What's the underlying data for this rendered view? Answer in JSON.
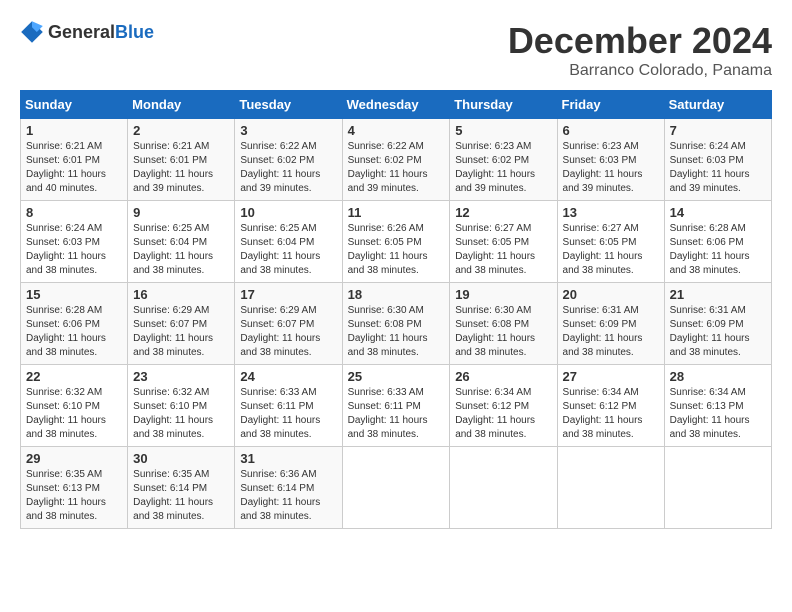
{
  "header": {
    "logo_general": "General",
    "logo_blue": "Blue",
    "title": "December 2024",
    "location": "Barranco Colorado, Panama"
  },
  "days_of_week": [
    "Sunday",
    "Monday",
    "Tuesday",
    "Wednesday",
    "Thursday",
    "Friday",
    "Saturday"
  ],
  "weeks": [
    [
      {
        "day": "1",
        "info": "Sunrise: 6:21 AM\nSunset: 6:01 PM\nDaylight: 11 hours and 40 minutes."
      },
      {
        "day": "2",
        "info": "Sunrise: 6:21 AM\nSunset: 6:01 PM\nDaylight: 11 hours and 39 minutes."
      },
      {
        "day": "3",
        "info": "Sunrise: 6:22 AM\nSunset: 6:02 PM\nDaylight: 11 hours and 39 minutes."
      },
      {
        "day": "4",
        "info": "Sunrise: 6:22 AM\nSunset: 6:02 PM\nDaylight: 11 hours and 39 minutes."
      },
      {
        "day": "5",
        "info": "Sunrise: 6:23 AM\nSunset: 6:02 PM\nDaylight: 11 hours and 39 minutes."
      },
      {
        "day": "6",
        "info": "Sunrise: 6:23 AM\nSunset: 6:03 PM\nDaylight: 11 hours and 39 minutes."
      },
      {
        "day": "7",
        "info": "Sunrise: 6:24 AM\nSunset: 6:03 PM\nDaylight: 11 hours and 39 minutes."
      }
    ],
    [
      {
        "day": "8",
        "info": "Sunrise: 6:24 AM\nSunset: 6:03 PM\nDaylight: 11 hours and 38 minutes."
      },
      {
        "day": "9",
        "info": "Sunrise: 6:25 AM\nSunset: 6:04 PM\nDaylight: 11 hours and 38 minutes."
      },
      {
        "day": "10",
        "info": "Sunrise: 6:25 AM\nSunset: 6:04 PM\nDaylight: 11 hours and 38 minutes."
      },
      {
        "day": "11",
        "info": "Sunrise: 6:26 AM\nSunset: 6:05 PM\nDaylight: 11 hours and 38 minutes."
      },
      {
        "day": "12",
        "info": "Sunrise: 6:27 AM\nSunset: 6:05 PM\nDaylight: 11 hours and 38 minutes."
      },
      {
        "day": "13",
        "info": "Sunrise: 6:27 AM\nSunset: 6:05 PM\nDaylight: 11 hours and 38 minutes."
      },
      {
        "day": "14",
        "info": "Sunrise: 6:28 AM\nSunset: 6:06 PM\nDaylight: 11 hours and 38 minutes."
      }
    ],
    [
      {
        "day": "15",
        "info": "Sunrise: 6:28 AM\nSunset: 6:06 PM\nDaylight: 11 hours and 38 minutes."
      },
      {
        "day": "16",
        "info": "Sunrise: 6:29 AM\nSunset: 6:07 PM\nDaylight: 11 hours and 38 minutes."
      },
      {
        "day": "17",
        "info": "Sunrise: 6:29 AM\nSunset: 6:07 PM\nDaylight: 11 hours and 38 minutes."
      },
      {
        "day": "18",
        "info": "Sunrise: 6:30 AM\nSunset: 6:08 PM\nDaylight: 11 hours and 38 minutes."
      },
      {
        "day": "19",
        "info": "Sunrise: 6:30 AM\nSunset: 6:08 PM\nDaylight: 11 hours and 38 minutes."
      },
      {
        "day": "20",
        "info": "Sunrise: 6:31 AM\nSunset: 6:09 PM\nDaylight: 11 hours and 38 minutes."
      },
      {
        "day": "21",
        "info": "Sunrise: 6:31 AM\nSunset: 6:09 PM\nDaylight: 11 hours and 38 minutes."
      }
    ],
    [
      {
        "day": "22",
        "info": "Sunrise: 6:32 AM\nSunset: 6:10 PM\nDaylight: 11 hours and 38 minutes."
      },
      {
        "day": "23",
        "info": "Sunrise: 6:32 AM\nSunset: 6:10 PM\nDaylight: 11 hours and 38 minutes."
      },
      {
        "day": "24",
        "info": "Sunrise: 6:33 AM\nSunset: 6:11 PM\nDaylight: 11 hours and 38 minutes."
      },
      {
        "day": "25",
        "info": "Sunrise: 6:33 AM\nSunset: 6:11 PM\nDaylight: 11 hours and 38 minutes."
      },
      {
        "day": "26",
        "info": "Sunrise: 6:34 AM\nSunset: 6:12 PM\nDaylight: 11 hours and 38 minutes."
      },
      {
        "day": "27",
        "info": "Sunrise: 6:34 AM\nSunset: 6:12 PM\nDaylight: 11 hours and 38 minutes."
      },
      {
        "day": "28",
        "info": "Sunrise: 6:34 AM\nSunset: 6:13 PM\nDaylight: 11 hours and 38 minutes."
      }
    ],
    [
      {
        "day": "29",
        "info": "Sunrise: 6:35 AM\nSunset: 6:13 PM\nDaylight: 11 hours and 38 minutes."
      },
      {
        "day": "30",
        "info": "Sunrise: 6:35 AM\nSunset: 6:14 PM\nDaylight: 11 hours and 38 minutes."
      },
      {
        "day": "31",
        "info": "Sunrise: 6:36 AM\nSunset: 6:14 PM\nDaylight: 11 hours and 38 minutes."
      },
      null,
      null,
      null,
      null
    ]
  ]
}
